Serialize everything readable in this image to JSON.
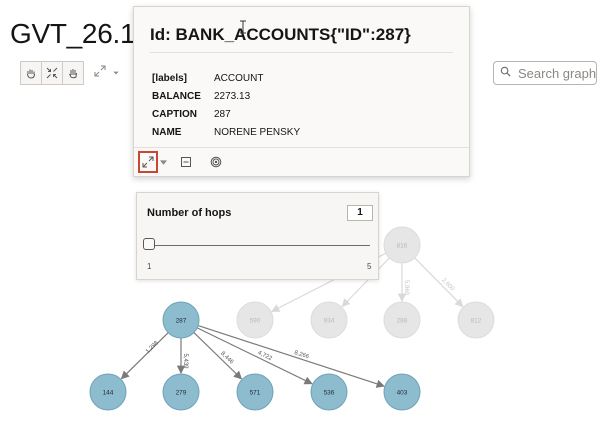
{
  "app": {
    "title": "GVT_26.1.1"
  },
  "toolbar": {
    "buttons": [
      {
        "icon": "hand-pan-icon"
      },
      {
        "icon": "shrink-arrows-icon"
      },
      {
        "icon": "hand-select-icon"
      }
    ],
    "extra": [
      {
        "icon": "expand-arrows-icon"
      },
      {
        "icon": "chevron-down-icon"
      }
    ]
  },
  "search": {
    "placeholder": "Search graph"
  },
  "popover": {
    "title": "Id: BANK_ACCOUNTS{\"ID\":287}",
    "properties": [
      {
        "key": "[labels]",
        "value": "ACCOUNT"
      },
      {
        "key": "BALANCE",
        "value": "2273.13"
      },
      {
        "key": "CAPTION",
        "value": "287"
      },
      {
        "key": "NAME",
        "value": "NORENE PENSKY"
      }
    ],
    "actions": [
      {
        "icon": "expand-icon",
        "active": true
      },
      {
        "icon": "chevron-down-icon"
      },
      {
        "icon": "collapse-minus-icon"
      },
      {
        "icon": "focus-target-icon"
      }
    ]
  },
  "hops": {
    "label": "Number of hops",
    "value": "1",
    "min_label": "1",
    "max_label": "5",
    "slider_fraction": 0
  },
  "graph": {
    "colors": {
      "active_node": "#8dbccf",
      "active_node_border": "#6ea3b8",
      "faded_node": "#e6e6e6",
      "active_edge": "#7a7a7a",
      "faded_edge": "#d9d9d9"
    },
    "nodes": [
      {
        "id": "287",
        "active": true
      },
      {
        "id": "144",
        "active": true
      },
      {
        "id": "279",
        "active": true
      },
      {
        "id": "571",
        "active": true
      },
      {
        "id": "536",
        "active": true
      },
      {
        "id": "403",
        "active": true
      },
      {
        "id": "590",
        "active": false
      },
      {
        "id": "934",
        "active": false
      },
      {
        "id": "288",
        "active": false
      },
      {
        "id": "812",
        "active": false
      },
      {
        "id": "816",
        "active": false
      }
    ],
    "edges": [
      {
        "from": "287",
        "to": "144",
        "label": "1,298",
        "active": true
      },
      {
        "from": "287",
        "to": "279",
        "label": "5,439",
        "active": true
      },
      {
        "from": "287",
        "to": "571",
        "label": "8,446",
        "active": true
      },
      {
        "from": "287",
        "to": "536",
        "label": "4,722",
        "active": true
      },
      {
        "from": "287",
        "to": "403",
        "label": "8,266",
        "active": true
      },
      {
        "from": "816",
        "to": "590",
        "label": "670",
        "active": false
      },
      {
        "from": "816",
        "to": "934",
        "label": "8,000",
        "active": false
      },
      {
        "from": "816",
        "to": "288",
        "label": "5,960",
        "active": false
      },
      {
        "from": "816",
        "to": "812",
        "label": "2,600",
        "active": false
      }
    ]
  }
}
